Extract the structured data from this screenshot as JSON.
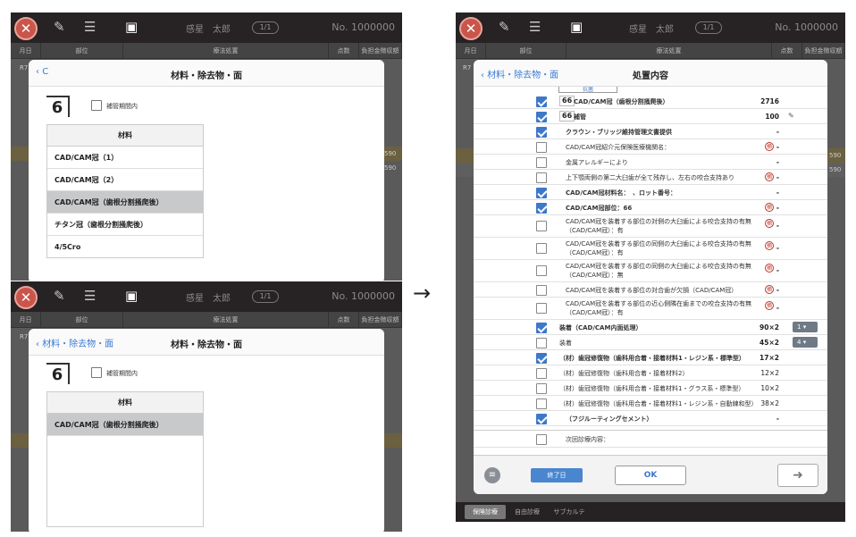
{
  "topbar": {
    "patient_name": "感星　太郎",
    "page_indicator": "1/1",
    "patient_no": "No. 1000000"
  },
  "grid_headers": [
    "月日",
    "部位",
    "療法処置",
    "点数",
    "負担金徴収額"
  ],
  "grid_side": {
    "r7": "R7",
    "num": "590"
  },
  "top_left_modal": {
    "back": "C",
    "title": "材料・除去物・面",
    "tooth": "6",
    "checkbox_label": "補管期間内",
    "material_header": "材料",
    "materials": [
      "CAD/CAM冠（1）",
      "CAD/CAM冠（2）",
      "CAD/CAM冠（歯根分割掻爬後）",
      "チタン冠（歯根分割掻爬後）",
      "4/5Cro"
    ],
    "selected_index": 2
  },
  "bottom_left_modal": {
    "back": "材料・除去物・面",
    "title": "材料・除去物・面",
    "tooth": "6",
    "checkbox_label": "補管期間内",
    "material_header": "材料",
    "materials": [
      "CAD/CAM冠（歯根分割掻爬後）"
    ],
    "selected_index": 0
  },
  "arrow": "→",
  "right_modal": {
    "back": "材料・除去物・面",
    "title": "処置内容",
    "top_partial": "抗菌",
    "rows": [
      {
        "checked": true,
        "tooth": "66",
        "text": "CAD/CAM冠（歯根分割掻爬後）",
        "points": "2716",
        "bold": true
      },
      {
        "checked": true,
        "tooth": "66",
        "text": "補管",
        "points": "100",
        "bold": true,
        "pencil": true
      },
      {
        "checked": true,
        "text": "クラウン・ブリッジ維持管理文書提供",
        "points": "-",
        "bold": true
      },
      {
        "checked": false,
        "text": "CAD/CAM冠紹介元保険医療機関名：",
        "points": "-",
        "mark": "摘"
      },
      {
        "checked": false,
        "text": "金属アレルギーにより",
        "points": "-"
      },
      {
        "checked": false,
        "text": "上下顎両側の第二大臼歯が全て残存し、左右の咬合支持あり",
        "points": "-",
        "mark": "摘"
      },
      {
        "checked": true,
        "text": "CAD/CAM冠材料名：　、ロット番号：",
        "points": "-",
        "bold": true
      },
      {
        "checked": true,
        "text": "CAD/CAM冠部位：66",
        "points": "-",
        "bold": true,
        "mark": "摘"
      },
      {
        "checked": false,
        "text": "CAD/CAM冠を装着する部位の対側の大臼歯による咬合支持の有無（CAD/CAM冠）：有",
        "points": "-",
        "mark": "摘",
        "tall": true
      },
      {
        "checked": false,
        "text": "CAD/CAM冠を装着する部位の同側の大臼歯による咬合支持の有無（CAD/CAM冠）：有",
        "points": "-",
        "mark": "摘",
        "tall": true
      },
      {
        "checked": false,
        "text": "CAD/CAM冠を装着する部位の同側の大臼歯による咬合支持の有無（CAD/CAM冠）：無",
        "points": "-",
        "mark": "摘",
        "tall": true
      },
      {
        "checked": false,
        "text": "CAD/CAM冠を装着する部位の対合歯が欠損（CAD/CAM冠）",
        "points": "-",
        "mark": "摘"
      },
      {
        "checked": false,
        "text": "CAD/CAM冠を装着する部位の近心側隣在歯までの咬合支持の有無（CAD/CAM冠）：有",
        "points": "-",
        "mark": "摘",
        "tall": true
      },
      {
        "checked": true,
        "text": "装着（CAD/CAM内面処理）",
        "points": "90×2",
        "bold": true,
        "dropdown": "1"
      },
      {
        "checked": false,
        "text": "装着",
        "points": "45×2",
        "dropdown": "4"
      },
      {
        "checked": true,
        "text": "（材）歯冠修復物（歯科用合着・接着材料1・レジン系・標準型）",
        "points": "17×2",
        "bold": true
      },
      {
        "checked": false,
        "text": "（材）歯冠修復物（歯科用合着・接着材料2）",
        "points": "12×2"
      },
      {
        "checked": false,
        "text": "（材）歯冠修復物（歯科用合着・接着材料1・グラス系・標準型）",
        "points": "10×2"
      },
      {
        "checked": false,
        "text": "（材）歯冠修復物（歯科用合着・接着材料1・レジン系・自動練和型）",
        "points": "38×2"
      },
      {
        "checked": true,
        "text": "（フジルーティングセメント）",
        "points": "-",
        "bold": true
      },
      {
        "checked": false,
        "text": "次回診療内容：",
        "points": ""
      }
    ],
    "end_day_label": "終了日",
    "ok_label": "OK",
    "next_arrow": "➜"
  },
  "bottom_tabs": [
    "保険診療",
    "自由診療",
    "サブカルテ"
  ],
  "colors": {
    "accent": "#3d78c9",
    "close": "#c9554b",
    "topbar": "#272223"
  }
}
